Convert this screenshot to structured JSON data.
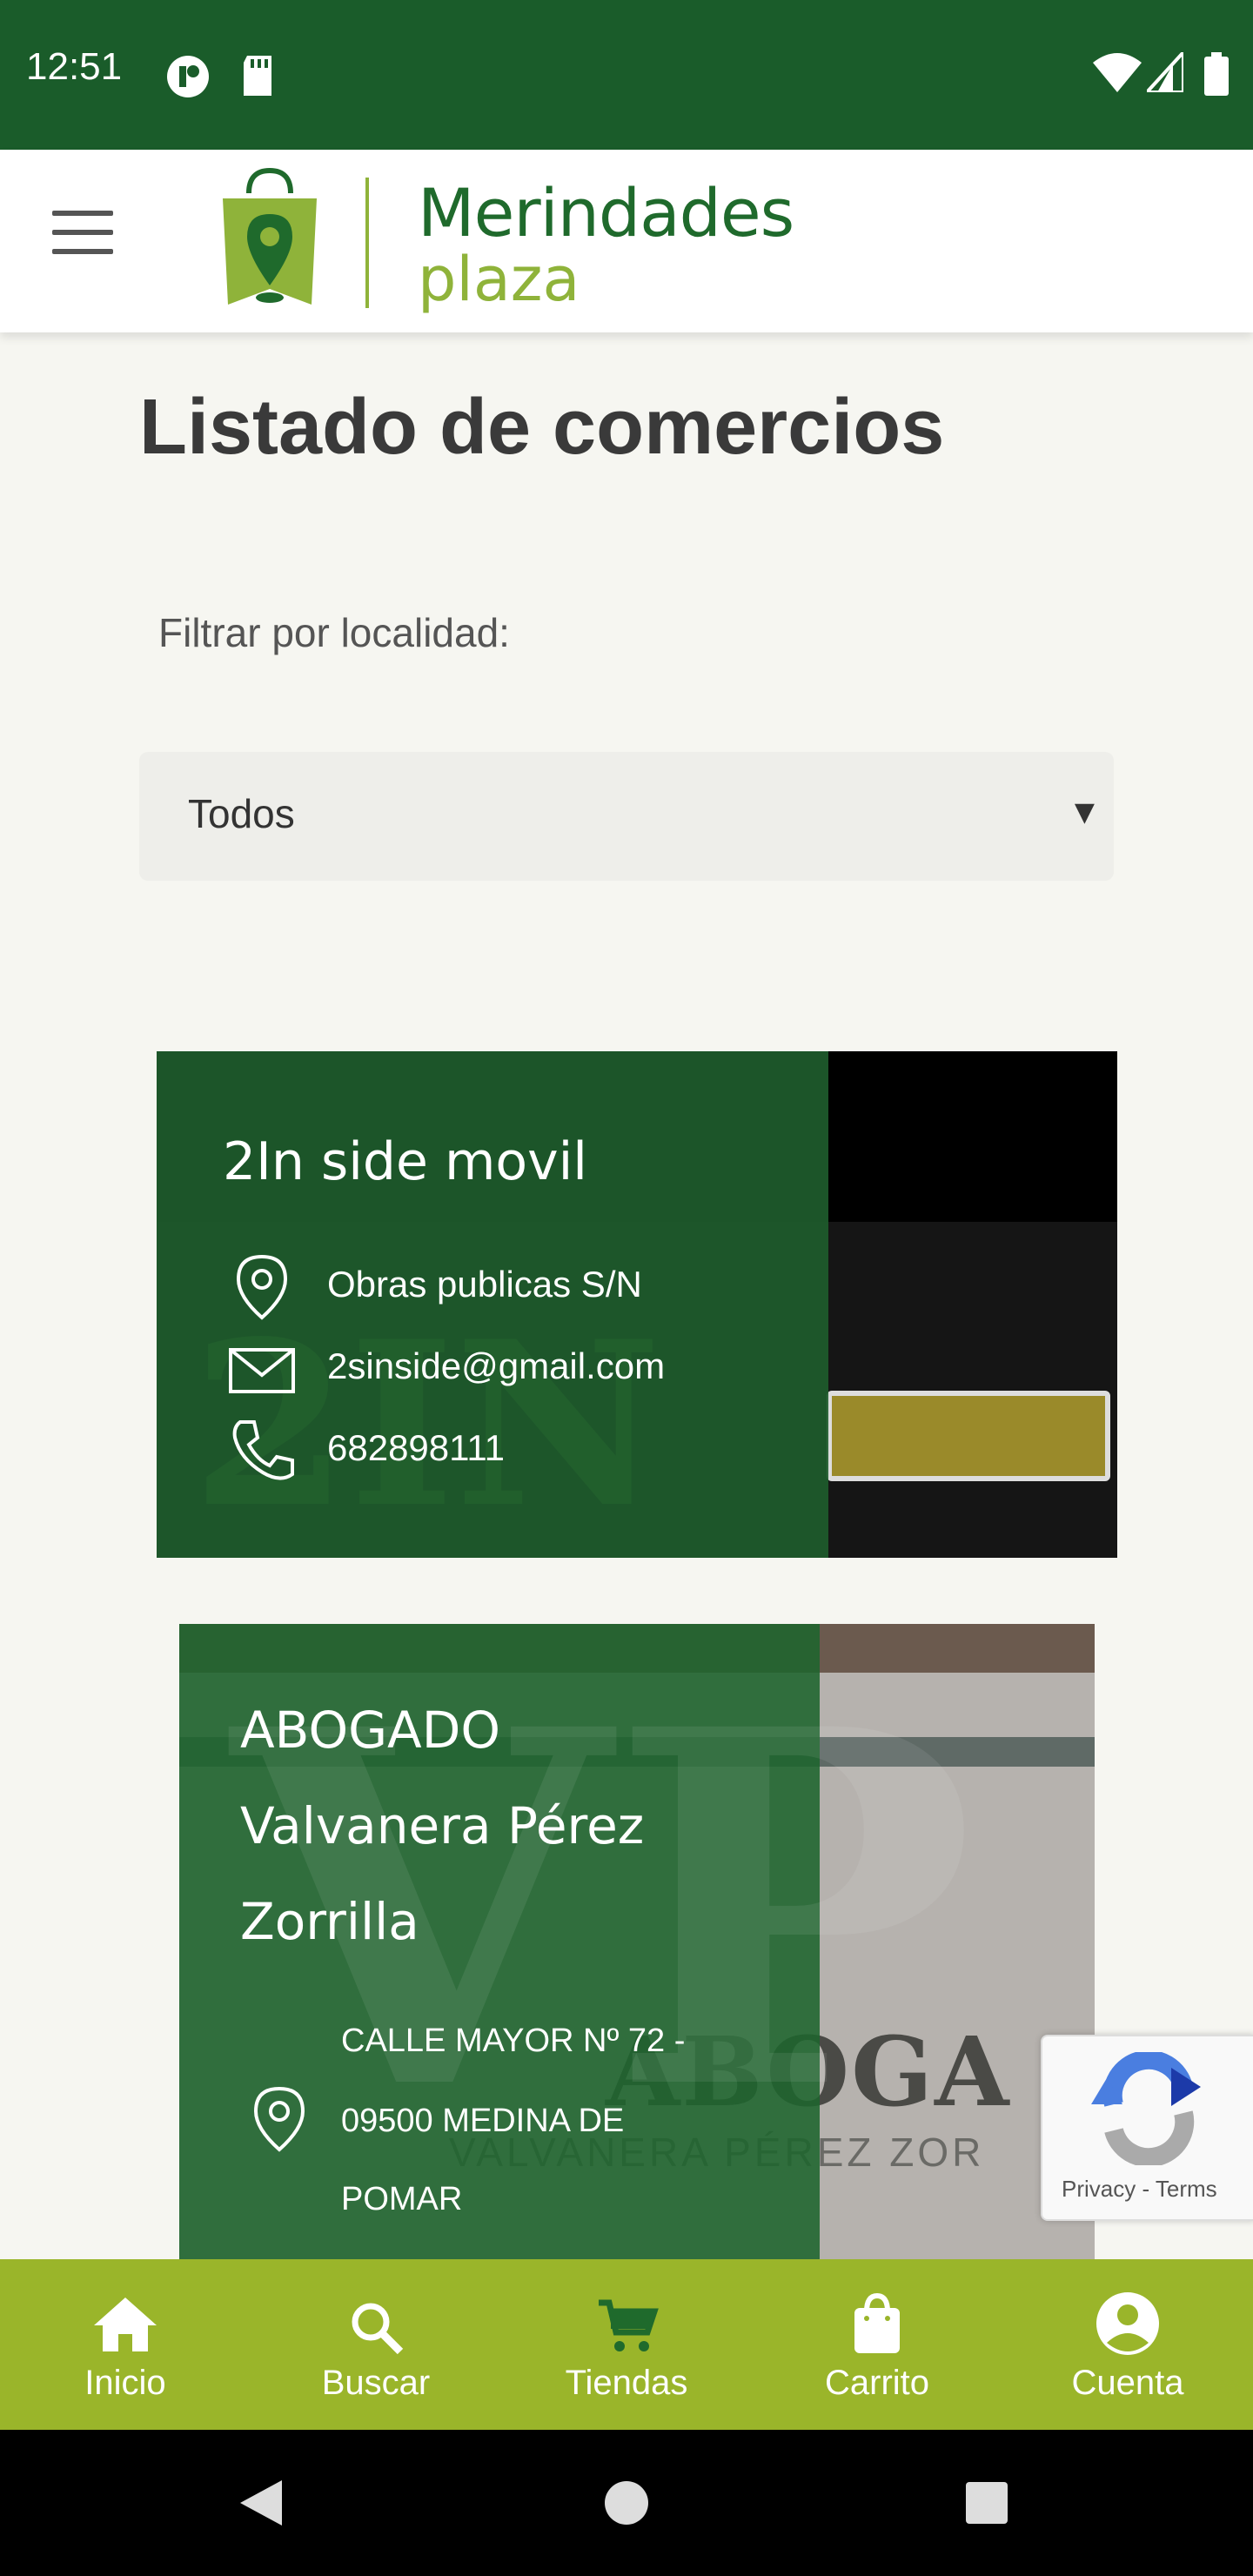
{
  "status_bar": {
    "time": "12:51"
  },
  "header": {
    "brand_line1": "Merindades",
    "brand_line2": "plaza"
  },
  "page": {
    "title": "Listado de comercios",
    "filter_label": "Filtrar por localidad:",
    "filter_value": "Todos"
  },
  "stores": [
    {
      "name": "2In side movil",
      "address": "Obras publicas S/N",
      "email": "2sinside@gmail.com",
      "phone": "682898111"
    },
    {
      "name_lines": [
        "ABOGADO",
        "Valvanera Pérez",
        "Zorrilla"
      ],
      "address_lines": [
        "CALLE MAYOR Nº 72 -",
        "09500 MEDINA DE",
        "POMAR"
      ],
      "image_text_1": "ABOGA",
      "image_text_2": "VALVANERA PÉREZ ZOR"
    }
  ],
  "recaptcha": {
    "privacy": "Privacy",
    "sep": " - ",
    "terms": "Terms"
  },
  "bottom_nav": [
    {
      "label": "Inicio",
      "icon": "home-icon"
    },
    {
      "label": "Buscar",
      "icon": "search-icon"
    },
    {
      "label": "Tiendas",
      "icon": "cart-icon"
    },
    {
      "label": "Carrito",
      "icon": "bag-icon"
    },
    {
      "label": "Cuenta",
      "icon": "account-icon"
    }
  ],
  "colors": {
    "status_bar": "#1a5c2a",
    "brand_green": "#1f6a2c",
    "brand_lime": "#8fb33a",
    "nav_bg": "#9ab52a",
    "card_overlay": "#1e5c2c"
  }
}
